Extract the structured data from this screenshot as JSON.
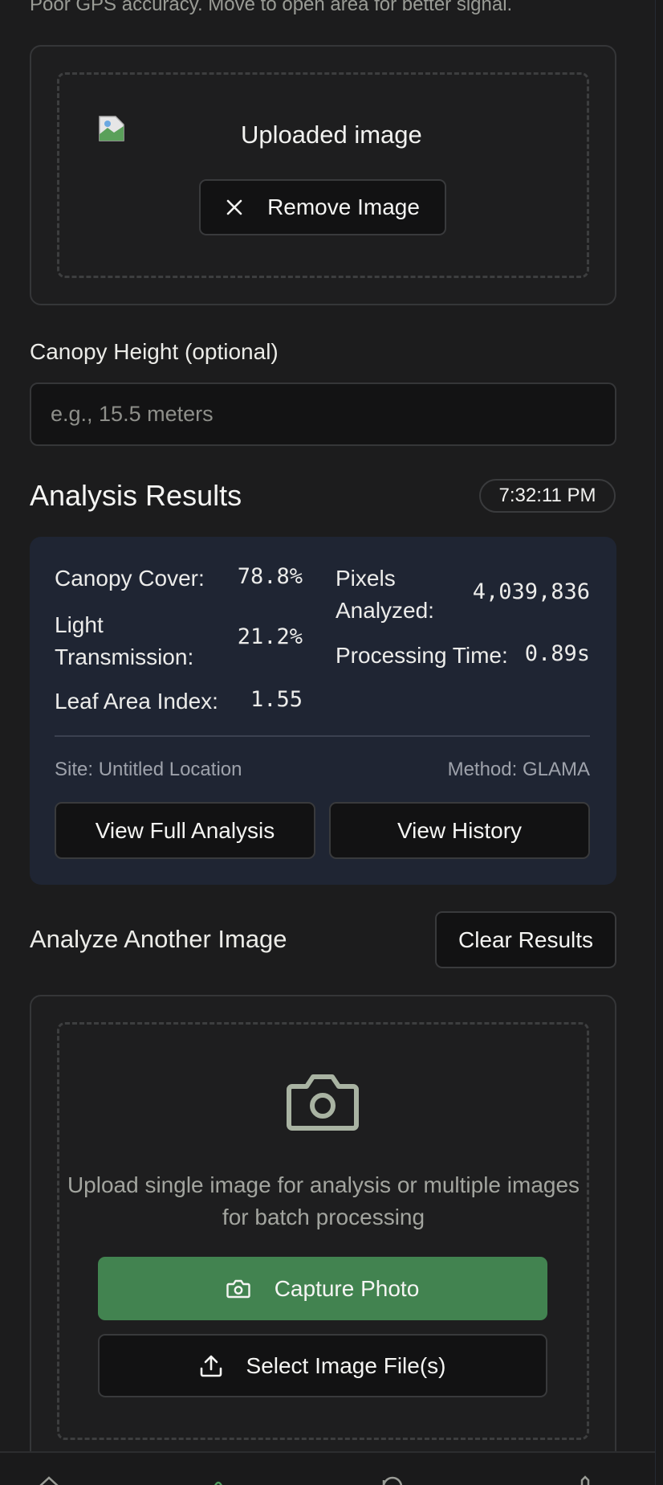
{
  "gps_note": "Poor GPS accuracy. Move to open area for better signal.",
  "upload_preview": {
    "image_alt": "Uploaded image",
    "remove_label": "Remove Image"
  },
  "canopy_height": {
    "label": "Canopy Height (optional)",
    "placeholder": "e.g., 15.5 meters",
    "value": ""
  },
  "results": {
    "title": "Analysis Results",
    "time": "7:32:11 PM",
    "metrics": [
      {
        "label": "Canopy Cover:",
        "value": "78.8%"
      },
      {
        "label": "Light Transmission:",
        "value": "21.2%"
      },
      {
        "label": "Leaf Area Index:",
        "value": "1.55"
      },
      {
        "label": "Pixels Analyzed:",
        "value": "4,039,836"
      },
      {
        "label": "Processing Time:",
        "value": "0.89s"
      }
    ],
    "site": "Site: Untitled Location",
    "method": "Method: GLAMA",
    "view_full_label": "View Full Analysis",
    "view_history_label": "View History"
  },
  "analyze_another": {
    "title": "Analyze Another Image",
    "clear_label": "Clear Results",
    "hint": "Upload single image for analysis or multiple images for batch processing",
    "capture_label": "Capture Photo",
    "select_label": "Select Image File(s)"
  },
  "icons": {
    "camera": "camera-icon",
    "upload": "upload-icon",
    "close": "close-icon",
    "nav": [
      "home-icon",
      "leaf-icon",
      "history-icon",
      "settings-icon"
    ]
  },
  "colors": {
    "background": "#1c1c1d",
    "results_panel": "#1f2533",
    "primary_button": "#428350"
  }
}
